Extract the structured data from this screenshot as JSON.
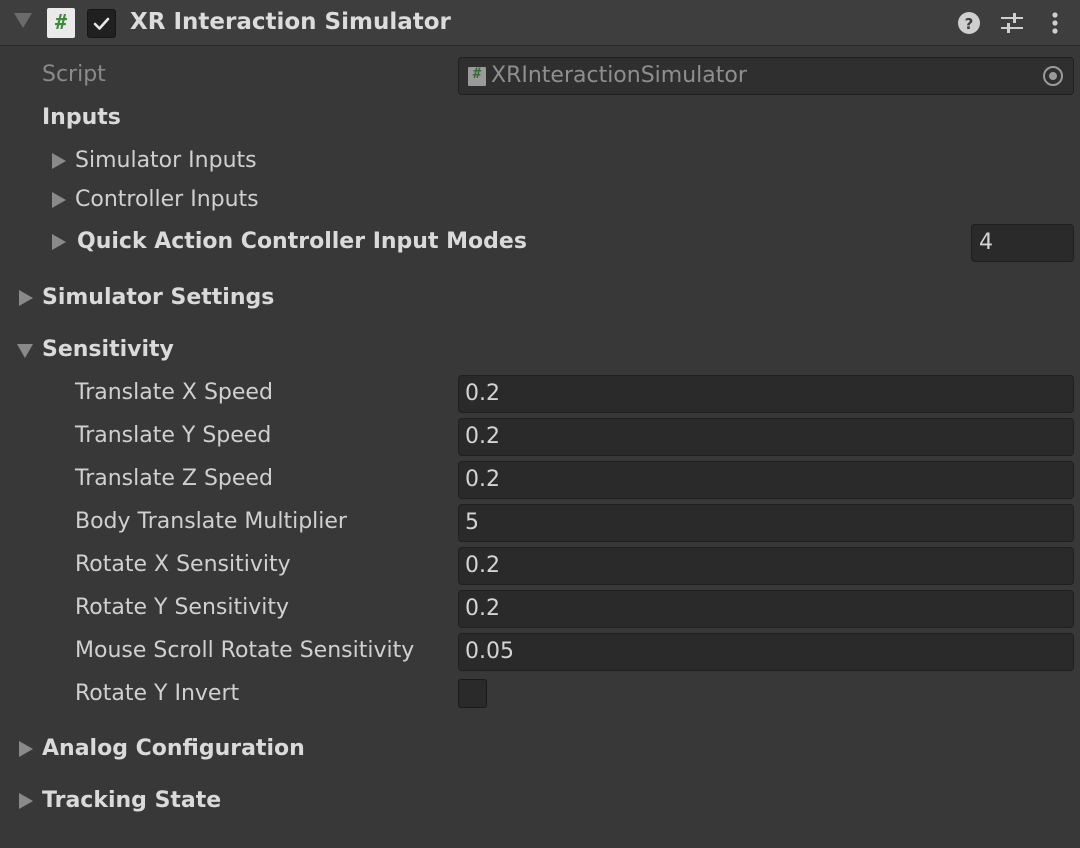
{
  "header": {
    "title": "XR Interaction Simulator",
    "enabled": true,
    "script_icon_glyph": "#",
    "icons": [
      "fold-down-icon",
      "script-icon",
      "checkbox-icon",
      "help-icon",
      "preset-sliders-icon",
      "kebab-menu-icon"
    ]
  },
  "script": {
    "label": "Script",
    "value": "XRInteractionSimulator",
    "icon_glyph": "#"
  },
  "inputs": {
    "label": "Inputs",
    "simulator_inputs": "Simulator Inputs",
    "controller_inputs": "Controller Inputs",
    "quick_action_modes": {
      "label": "Quick Action Controller Input Modes",
      "count": "4"
    }
  },
  "simulator_settings": {
    "label": "Simulator Settings",
    "expanded": false
  },
  "sensitivity": {
    "label": "Sensitivity",
    "expanded": true,
    "fields": [
      {
        "label": "Translate X Speed",
        "value": "0.2"
      },
      {
        "label": "Translate Y Speed",
        "value": "0.2"
      },
      {
        "label": "Translate Z Speed",
        "value": "0.2"
      },
      {
        "label": "Body Translate Multiplier",
        "value": "5"
      },
      {
        "label": "Rotate X Sensitivity",
        "value": "0.2"
      },
      {
        "label": "Rotate Y Sensitivity",
        "value": "0.2"
      },
      {
        "label": "Mouse Scroll Rotate Sensitivity",
        "value": "0.05"
      }
    ],
    "rotate_y_invert": {
      "label": "Rotate Y Invert",
      "checked": false
    }
  },
  "analog_configuration": {
    "label": "Analog Configuration",
    "expanded": false
  },
  "tracking_state": {
    "label": "Tracking State",
    "expanded": false
  },
  "colors": {
    "panel_bg": "#383838",
    "header_bg": "#3e3e3e",
    "field_bg": "#2a2a2a",
    "text": "#d2d2d2",
    "dim_text": "#8a8a8a",
    "script_icon_green": "#3d8a3a"
  }
}
